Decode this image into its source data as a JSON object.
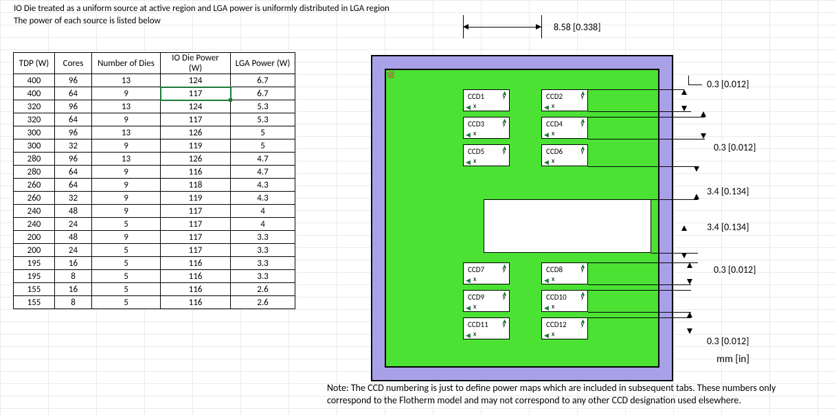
{
  "description": {
    "line1": "IO Die treated as a uniform source at active region and LGA power is uniformly distributed in LGA region",
    "line2": "The power of each source is listed below"
  },
  "table": {
    "headers": {
      "tdp": "TDP (W)",
      "cores": "Cores",
      "dies": "Number of Dies",
      "iodie": "IO Die Power (W)",
      "lga": "LGA Power (W)"
    },
    "rows": [
      {
        "tdp": "400",
        "cores": "96",
        "dies": "13",
        "io": "124",
        "lga": "6.7"
      },
      {
        "tdp": "400",
        "cores": "64",
        "dies": "9",
        "io": "117",
        "lga": "6.7"
      },
      {
        "tdp": "320",
        "cores": "96",
        "dies": "13",
        "io": "124",
        "lga": "5.3"
      },
      {
        "tdp": "320",
        "cores": "64",
        "dies": "9",
        "io": "117",
        "lga": "5.3"
      },
      {
        "tdp": "300",
        "cores": "96",
        "dies": "13",
        "io": "126",
        "lga": "5"
      },
      {
        "tdp": "300",
        "cores": "32",
        "dies": "9",
        "io": "119",
        "lga": "5"
      },
      {
        "tdp": "280",
        "cores": "96",
        "dies": "13",
        "io": "126",
        "lga": "4.7"
      },
      {
        "tdp": "280",
        "cores": "64",
        "dies": "9",
        "io": "116",
        "lga": "4.7"
      },
      {
        "tdp": "260",
        "cores": "64",
        "dies": "9",
        "io": "118",
        "lga": "4.3"
      },
      {
        "tdp": "260",
        "cores": "32",
        "dies": "9",
        "io": "119",
        "lga": "4.3"
      },
      {
        "tdp": "240",
        "cores": "48",
        "dies": "9",
        "io": "117",
        "lga": "4"
      },
      {
        "tdp": "240",
        "cores": "24",
        "dies": "5",
        "io": "117",
        "lga": "4"
      },
      {
        "tdp": "200",
        "cores": "48",
        "dies": "9",
        "io": "117",
        "lga": "3.3"
      },
      {
        "tdp": "200",
        "cores": "24",
        "dies": "5",
        "io": "117",
        "lga": "3.3"
      },
      {
        "tdp": "195",
        "cores": "16",
        "dies": "5",
        "io": "116",
        "lga": "3.3"
      },
      {
        "tdp": "195",
        "cores": "8",
        "dies": "5",
        "io": "116",
        "lga": "3.3"
      },
      {
        "tdp": "155",
        "cores": "16",
        "dies": "5",
        "io": "116",
        "lga": "2.6"
      },
      {
        "tdp": "155",
        "cores": "8",
        "dies": "5",
        "io": "116",
        "lga": "2.6"
      }
    ]
  },
  "diagram": {
    "ccd_labels": [
      "CCD1",
      "CCD2",
      "CCD3",
      "CCD4",
      "CCD5",
      "CCD6",
      "CCD7",
      "CCD8",
      "CCD9",
      "CCD10",
      "CCD11",
      "CCD12"
    ],
    "axis_x": "x",
    "axis_y": "y",
    "dim_top": "8.58 [0.338]",
    "dim_r1": "0.3 [0.012]",
    "dim_r2": "0.3 [0.012]",
    "dim_r3": "3.4 [0.134]",
    "dim_r4": "3.4 [0.134]",
    "dim_r5": "0.3 [0.012]",
    "dim_r6": "0.3 [0.012]",
    "unit": "mm [in]"
  },
  "note": "Note: The CCD numbering is just to define power maps which are included in subsequent tabs. These numbers only correspond to the Flotherm model and may not correspond to any other CCD designation used elsewhere."
}
